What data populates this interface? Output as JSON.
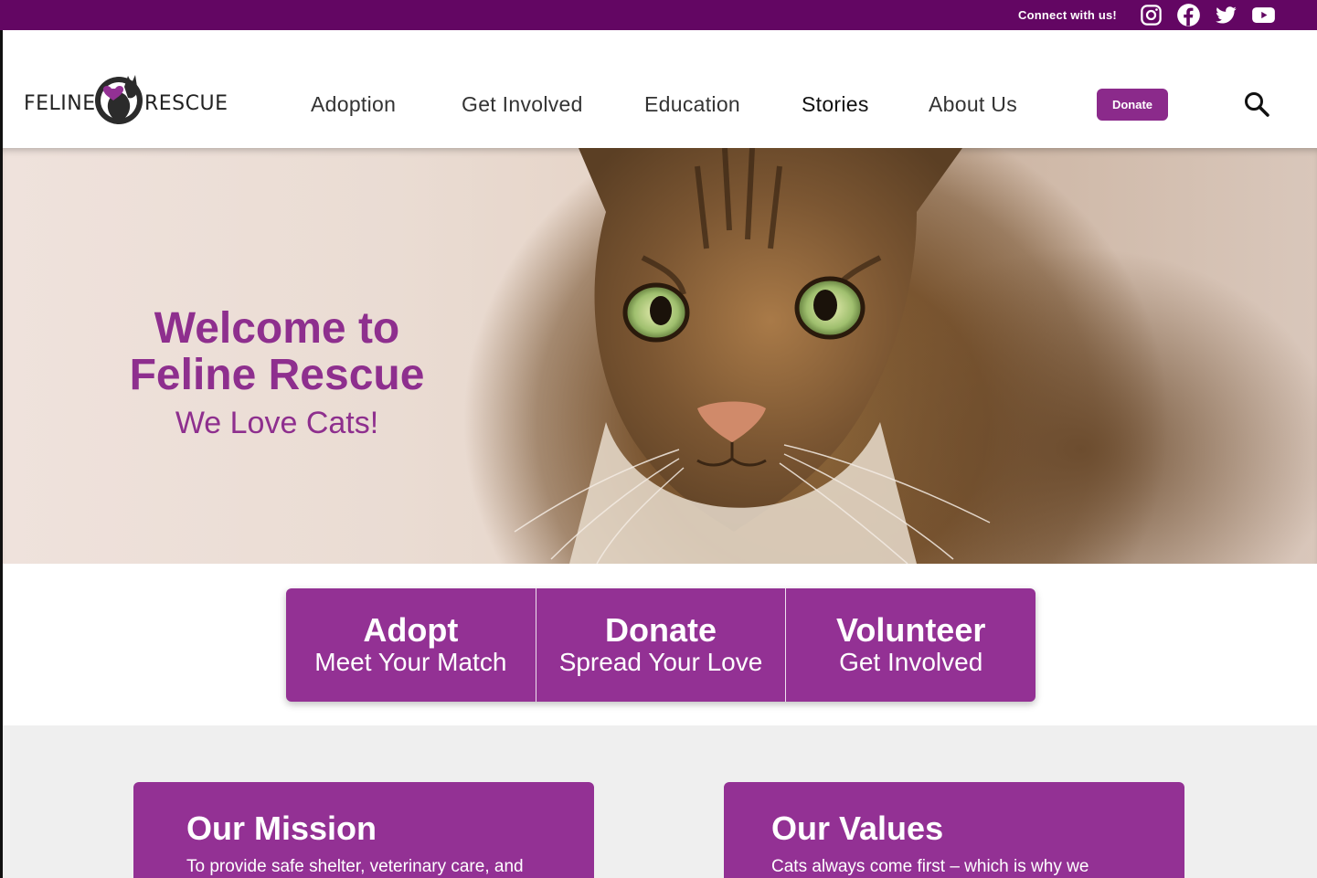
{
  "topbar": {
    "connect_label": "Connect with us!",
    "social": [
      "instagram-icon",
      "facebook-icon",
      "twitter-icon",
      "youtube-icon"
    ]
  },
  "brand": {
    "logo_left": "FELINE",
    "logo_right": "RESCUE"
  },
  "nav": {
    "items": [
      {
        "label": "Adoption"
      },
      {
        "label": "Get Involved"
      },
      {
        "label": "Education"
      },
      {
        "label": "Stories"
      },
      {
        "label": "About Us"
      }
    ],
    "donate_label": "Donate",
    "search_icon": "search-icon"
  },
  "hero": {
    "title_line1": "Welcome to",
    "title_line2": "Feline Rescue",
    "subtitle": "We Love Cats!"
  },
  "cta": [
    {
      "title": "Adopt",
      "subtitle": "Meet Your Match"
    },
    {
      "title": "Donate",
      "subtitle": "Spread Your Love"
    },
    {
      "title": "Volunteer",
      "subtitle": "Get Involved"
    }
  ],
  "cards": [
    {
      "title": "Our Mission",
      "text": "To provide safe shelter, veterinary care, and"
    },
    {
      "title": "Our Values",
      "text": "Cats always come first – which is why we"
    }
  ],
  "colors": {
    "brand_purple": "#933194",
    "topbar_purple": "#630663",
    "heading_purple": "#8e2f8e"
  }
}
